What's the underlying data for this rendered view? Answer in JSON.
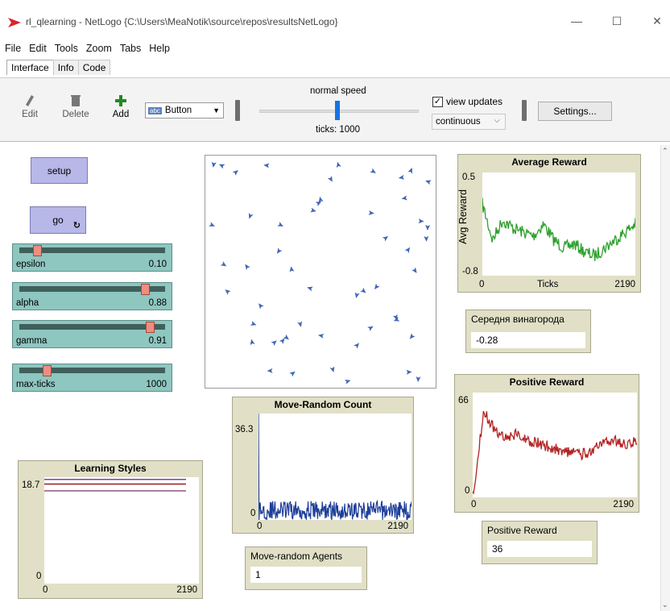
{
  "window": {
    "title": "rl_qlearning - NetLogo {C:\\Users\\MeaNotik\\source\\repos\\resultsNetLogo}",
    "minimize": "—",
    "maximize": "☐",
    "close": "✕"
  },
  "menu": [
    "File",
    "Edit",
    "Tools",
    "Zoom",
    "Tabs",
    "Help"
  ],
  "tabs": [
    "Interface",
    "Info",
    "Code"
  ],
  "toolbar": {
    "edit": "Edit",
    "delete": "Delete",
    "add": "Add",
    "widget_type": "Button",
    "widget_type_tag": "abc",
    "speed_label": "normal speed",
    "ticks": "ticks: 1000",
    "view_updates_label": "view updates",
    "view_updates_checked": true,
    "update_mode": "continuous",
    "settings": "Settings..."
  },
  "buttons": {
    "setup": "setup",
    "go": "go"
  },
  "sliders": [
    {
      "name": "epsilon",
      "value": "0.10",
      "fraction": 0.1
    },
    {
      "name": "alpha",
      "value": "0.88",
      "fraction": 0.88
    },
    {
      "name": "gamma",
      "value": "0.91",
      "fraction": 0.91
    },
    {
      "name": "max-ticks",
      "value": "1000",
      "fraction": 0.17
    }
  ],
  "monitors": {
    "avg_reward": {
      "label": "Середня винагорода",
      "value": "-0.28"
    },
    "positive_reward": {
      "label": "Positive Reward",
      "value": "36"
    },
    "move_random_agents": {
      "label": "Move-random Agents",
      "value": "1"
    }
  },
  "colors": {
    "button": "#b7b7e8",
    "slider": "#8ec6c0",
    "plot_bg": "#e1e0c6",
    "turtle": "#3f67b5",
    "avg_line": "#2ca02c",
    "pos_line": "#b22222",
    "move_line": "#1f3f9a",
    "style_lines": [
      "#4b0082",
      "#8b0000",
      "#6a1f4f"
    ]
  },
  "chart_data": [
    {
      "type": "line",
      "title": "Average Reward",
      "xlabel": "Ticks",
      "ylabel": "Avg Reward",
      "x_min": "0",
      "x_max": "2190",
      "y_min": "-0.8",
      "y_max": "0.5",
      "xlim": [
        0,
        2190
      ],
      "ylim": [
        -0.8,
        0.5
      ],
      "series": [
        {
          "values": [
            0.1,
            -0.35,
            -0.1,
            -0.2,
            -0.25,
            -0.3,
            -0.15,
            -0.35,
            -0.45,
            -0.4,
            -0.5,
            -0.55,
            -0.45,
            -0.35,
            -0.25,
            -0.15
          ]
        }
      ]
    },
    {
      "type": "line",
      "title": "Move-Random Count",
      "x_min": "0",
      "x_max": "2190",
      "y_min": "0",
      "y_max": "36.3",
      "xlim": [
        0,
        2190
      ],
      "ylim": [
        0,
        36.3
      ],
      "series": [
        {
          "values": [
            36.3,
            4,
            2,
            3,
            2,
            4,
            3,
            2,
            5,
            3,
            2,
            4,
            3,
            2,
            3,
            4
          ]
        }
      ]
    },
    {
      "type": "line",
      "title": "Positive Reward",
      "x_min": "0",
      "x_max": "2190",
      "y_min": "0",
      "y_max": "66",
      "xlim": [
        0,
        2190
      ],
      "ylim": [
        0,
        66
      ],
      "series": [
        {
          "values": [
            0,
            55,
            42,
            38,
            40,
            36,
            34,
            32,
            30,
            28,
            27,
            30,
            34,
            36,
            33,
            35
          ]
        }
      ]
    },
    {
      "type": "line",
      "title": "Learning Styles",
      "x_min": "0",
      "x_max": "2190",
      "y_min": "0",
      "y_max": "18.7",
      "xlim": [
        0,
        2190
      ],
      "ylim": [
        0,
        18.7
      ],
      "series": [
        {
          "values": [
            18.3,
            18.3
          ]
        },
        {
          "values": [
            17.5,
            17.5
          ]
        },
        {
          "values": [
            16.3,
            16.3
          ]
        }
      ]
    }
  ]
}
